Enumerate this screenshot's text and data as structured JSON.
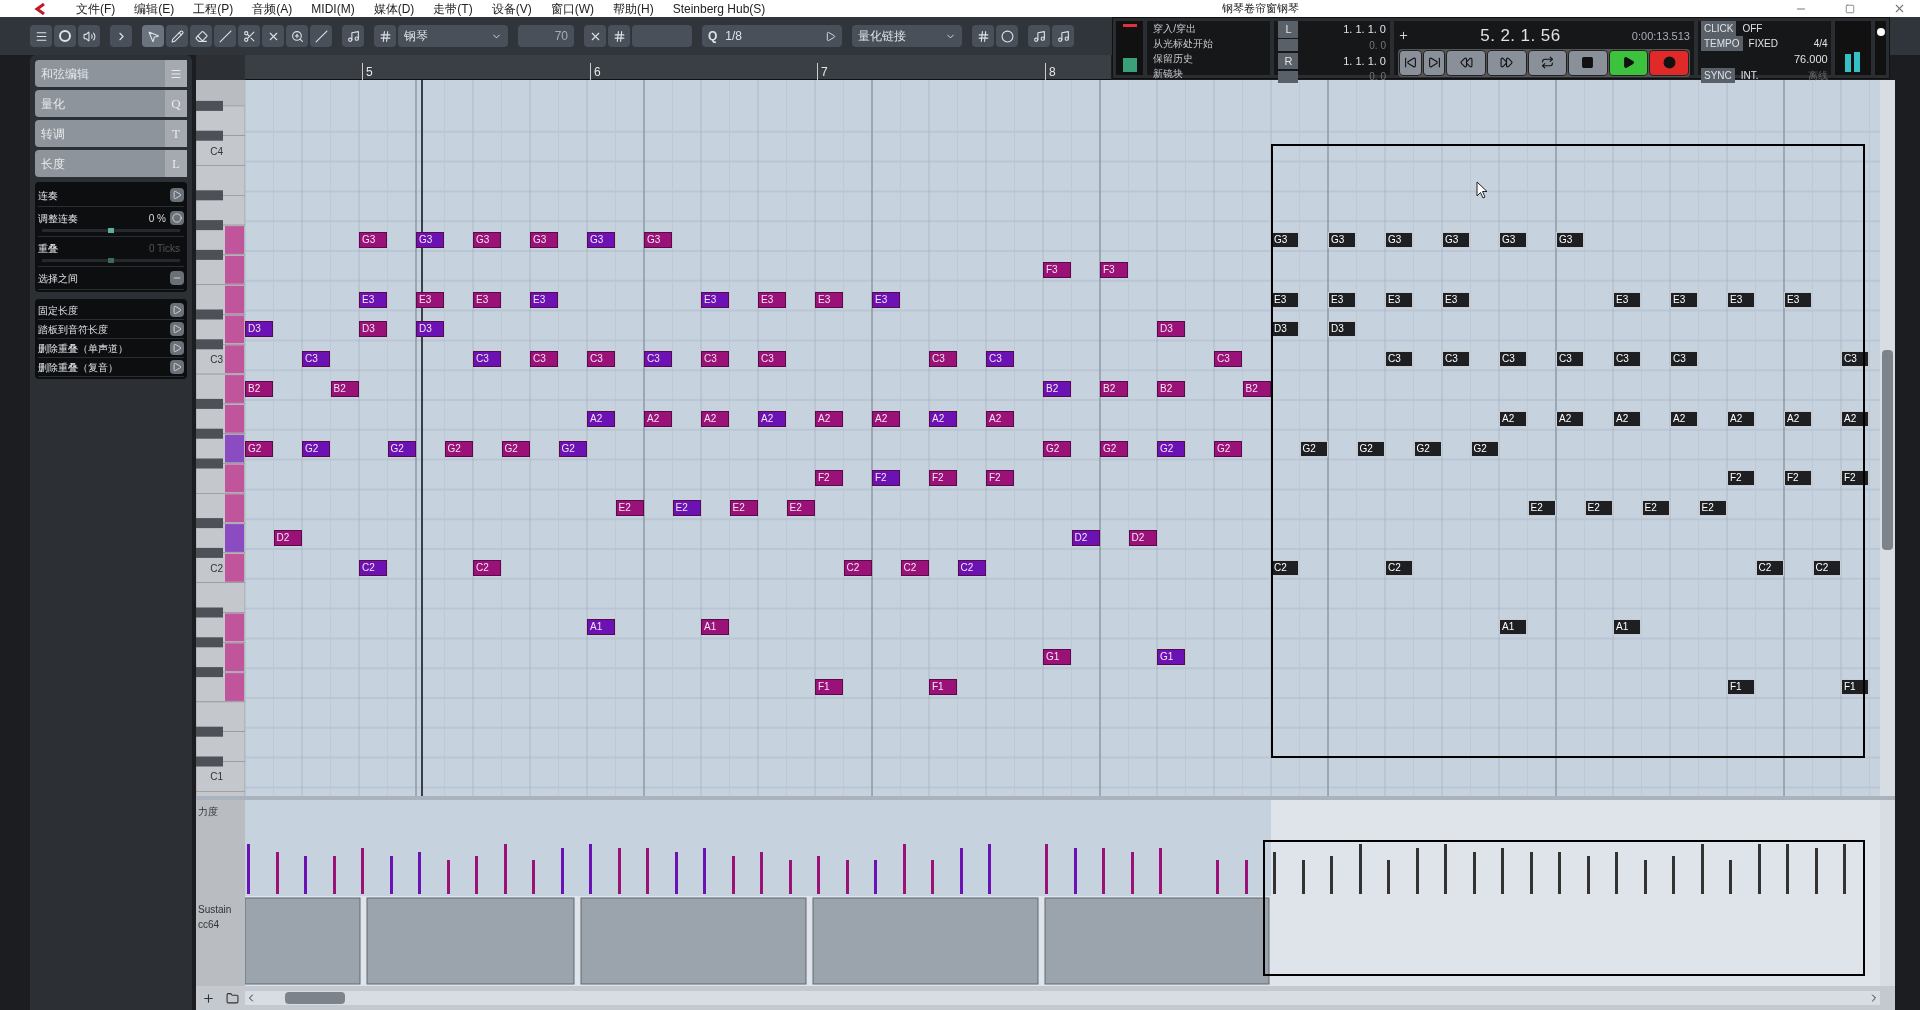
{
  "menu_bar": {
    "items": [
      "文件(F)",
      "编辑(E)",
      "工程(P)",
      "音频(A)",
      "MIDI(M)",
      "媒体(D)",
      "走带(T)",
      "设备(V)",
      "窗口(W)",
      "帮助(H)",
      "Steinberg Hub(S)"
    ]
  },
  "window": {
    "title": "钢琴卷帘窗钢琴"
  },
  "toolbar": {
    "instrument": "钢琴",
    "velocity": "70",
    "quantize_label": "Q",
    "quantize": "1/8",
    "length_quantize": "量化链接"
  },
  "transport": {
    "modes": [
      "穿入/穿出",
      "从光标处开始",
      "保留历史",
      "新镜块"
    ],
    "left_locator": {
      "label": "L",
      "position": "1. 1. 1. 0",
      "offset": "0. 0"
    },
    "right_locator": {
      "label": "R",
      "position": "1. 1. 1. 0",
      "offset": "0. 0"
    },
    "position": "5. 2. 1. 56",
    "time": "0:00:13.513",
    "buttons": [
      {
        "kind": "start",
        "on": false
      },
      {
        "kind": "end",
        "on": false
      },
      {
        "kind": "rewind",
        "on": false
      },
      {
        "kind": "forward",
        "on": false
      },
      {
        "kind": "cycle",
        "on": false
      },
      {
        "kind": "stop",
        "on": false
      },
      {
        "kind": "play",
        "on": true
      },
      {
        "kind": "record",
        "on": true
      }
    ],
    "click": {
      "label": "CLICK",
      "value": "OFF"
    },
    "tempo": {
      "label": "TEMPO",
      "value": "FIXED",
      "signature": "4/4",
      "bpm": "76.000"
    },
    "sync": {
      "label": "SYNC",
      "value": "INT.",
      "status": "离线"
    },
    "volume": {
      "level": 0.8
    }
  },
  "inspector": {
    "sections": [
      {
        "title": "和弦编辑",
        "kind": "icon"
      },
      {
        "title": "量化",
        "kind": "key",
        "key": "Q"
      },
      {
        "title": "转调",
        "kind": "key",
        "key": "T"
      },
      {
        "title": "长度",
        "kind": "key",
        "key": "L"
      }
    ],
    "legato": [
      {
        "kind": "button",
        "label": "连奏"
      },
      {
        "kind": "slider",
        "label": "调整连奏",
        "value": "0 %",
        "level": 0.5,
        "disabled": false
      },
      {
        "kind": "slider",
        "label": "重叠",
        "value": "0 Ticks",
        "level": 0.5,
        "disabled": true
      },
      {
        "kind": "toggle",
        "label": "选择之间"
      }
    ],
    "length_tools": [
      "固定长度",
      "踏板到音符长度",
      "删除重叠（单声道）",
      "删除重叠（复音）"
    ]
  },
  "ruler": {
    "bars": [
      "5",
      "6",
      "7",
      "8"
    ]
  },
  "keyboard": {
    "labels": [
      "C4",
      "C3",
      "C2",
      "C1"
    ]
  },
  "note_rows": [
    {
      "notes": [
        {
          "label": "G3",
          "selected": false
        },
        {
          "label": "G3",
          "selected": false
        },
        {
          "label": "G3",
          "selected": false
        },
        {
          "label": "G3",
          "selected": false
        },
        {
          "label": "G3",
          "selected": false
        },
        {
          "label": "G3",
          "selected": false
        },
        {
          "label": "G3",
          "selected": true
        },
        {
          "label": "G3",
          "selected": true
        },
        {
          "label": "G3",
          "selected": true
        },
        {
          "label": "G3",
          "selected": true
        },
        {
          "label": "G3",
          "selected": true
        },
        {
          "label": "G3",
          "selected": true
        }
      ]
    },
    {
      "notes": [
        {
          "label": "F3",
          "selected": false
        },
        {
          "label": "F3",
          "selected": false
        }
      ]
    },
    {
      "notes": [
        {
          "label": "E3",
          "selected": false
        },
        {
          "label": "E3",
          "selected": false
        },
        {
          "label": "E3",
          "selected": false
        },
        {
          "label": "E3",
          "selected": false
        },
        {
          "label": "E3",
          "selected": false
        },
        {
          "label": "E3",
          "selected": false
        },
        {
          "label": "E3",
          "selected": false
        },
        {
          "label": "E3",
          "selected": false
        },
        {
          "label": "E3",
          "selected": true
        },
        {
          "label": "E3",
          "selected": true
        },
        {
          "label": "E3",
          "selected": true
        },
        {
          "label": "E3",
          "selected": true
        },
        {
          "label": "E3",
          "selected": true
        },
        {
          "label": "E3",
          "selected": true
        },
        {
          "label": "E3",
          "selected": true
        },
        {
          "label": "E3",
          "selected": true
        }
      ]
    },
    {
      "notes": [
        {
          "label": "D3",
          "selected": false
        },
        {
          "label": "D3",
          "selected": false
        },
        {
          "label": "D3",
          "selected": false
        },
        {
          "label": "D3",
          "selected": false
        },
        {
          "label": "D3",
          "selected": true
        },
        {
          "label": "D3",
          "selected": true
        }
      ]
    },
    {
      "notes": [
        {
          "label": "C3",
          "selected": false
        },
        {
          "label": "C3",
          "selected": false
        },
        {
          "label": "C3",
          "selected": false
        },
        {
          "label": "C3",
          "selected": false
        },
        {
          "label": "C3",
          "selected": false
        },
        {
          "label": "C3",
          "selected": false
        },
        {
          "label": "C3",
          "selected": false
        },
        {
          "label": "C3",
          "selected": false
        },
        {
          "label": "C3",
          "selected": false
        },
        {
          "label": "C3",
          "selected": false
        },
        {
          "label": "C3",
          "selected": true
        },
        {
          "label": "C3",
          "selected": true
        },
        {
          "label": "C3",
          "selected": true
        },
        {
          "label": "C3",
          "selected": true
        },
        {
          "label": "C3",
          "selected": true
        },
        {
          "label": "C3",
          "selected": true
        },
        {
          "label": "C3",
          "selected": true
        }
      ]
    },
    {
      "notes": [
        {
          "label": "B2",
          "selected": false
        },
        {
          "label": "B2",
          "selected": false
        },
        {
          "label": "B2",
          "selected": false
        },
        {
          "label": "B2",
          "selected": false
        },
        {
          "label": "B2",
          "selected": false
        },
        {
          "label": "B2",
          "selected": false
        }
      ]
    },
    {
      "notes": [
        {
          "label": "A2",
          "selected": false
        },
        {
          "label": "A2",
          "selected": false
        },
        {
          "label": "A2",
          "selected": false
        },
        {
          "label": "A2",
          "selected": false
        },
        {
          "label": "A2",
          "selected": false
        },
        {
          "label": "A2",
          "selected": false
        },
        {
          "label": "A2",
          "selected": false
        },
        {
          "label": "A2",
          "selected": false
        },
        {
          "label": "A2",
          "selected": true
        },
        {
          "label": "A2",
          "selected": true
        },
        {
          "label": "A2",
          "selected": true
        },
        {
          "label": "A2",
          "selected": true
        },
        {
          "label": "A2",
          "selected": true
        },
        {
          "label": "A2",
          "selected": true
        },
        {
          "label": "A2",
          "selected": true
        }
      ]
    },
    {
      "notes": [
        {
          "label": "G2",
          "selected": false
        },
        {
          "label": "G2",
          "selected": false
        },
        {
          "label": "G2",
          "selected": false
        },
        {
          "label": "G2",
          "selected": false
        },
        {
          "label": "G2",
          "selected": false
        },
        {
          "label": "G2",
          "selected": false
        },
        {
          "label": "G2",
          "selected": false
        },
        {
          "label": "G2",
          "selected": false
        },
        {
          "label": "G2",
          "selected": false
        },
        {
          "label": "G2",
          "selected": false
        },
        {
          "label": "G2",
          "selected": true
        },
        {
          "label": "G2",
          "selected": true
        },
        {
          "label": "G2",
          "selected": true
        },
        {
          "label": "G2",
          "selected": true
        }
      ]
    },
    {
      "notes": [
        {
          "label": "F2",
          "selected": false
        },
        {
          "label": "F2",
          "selected": false
        },
        {
          "label": "F2",
          "selected": false
        },
        {
          "label": "F2",
          "selected": false
        },
        {
          "label": "F2",
          "selected": true
        },
        {
          "label": "F2",
          "selected": true
        },
        {
          "label": "F2",
          "selected": true
        }
      ]
    },
    {
      "notes": [
        {
          "label": "E2",
          "selected": false
        },
        {
          "label": "E2",
          "selected": false
        },
        {
          "label": "E2",
          "selected": false
        },
        {
          "label": "E2",
          "selected": false
        },
        {
          "label": "E2",
          "selected": true
        },
        {
          "label": "E2",
          "selected": true
        },
        {
          "label": "E2",
          "selected": true
        },
        {
          "label": "E2",
          "selected": true
        }
      ]
    },
    {
      "notes": [
        {
          "label": "D2",
          "selected": false
        },
        {
          "label": "D2",
          "selected": false
        },
        {
          "label": "D2",
          "selected": false
        }
      ]
    },
    {
      "notes": [
        {
          "label": "C2",
          "selected": false
        },
        {
          "label": "C2",
          "selected": false
        },
        {
          "label": "C2",
          "selected": false
        },
        {
          "label": "C2",
          "selected": false
        },
        {
          "label": "C2",
          "selected": false
        },
        {
          "label": "C2",
          "selected": true
        },
        {
          "label": "C2",
          "selected": true
        },
        {
          "label": "C2",
          "selected": true
        },
        {
          "label": "C2",
          "selected": true
        }
      ]
    },
    {
      "notes": [
        {
          "label": "A1",
          "selected": false
        },
        {
          "label": "A1",
          "selected": false
        },
        {
          "label": "A1",
          "selected": true
        },
        {
          "label": "A1",
          "selected": true
        }
      ]
    },
    {
      "notes": [
        {
          "label": "G1",
          "selected": false
        },
        {
          "label": "G1",
          "selected": false
        }
      ]
    },
    {
      "notes": [
        {
          "label": "F1",
          "selected": false
        },
        {
          "label": "F1",
          "selected": false
        },
        {
          "label": "F1",
          "selected": true
        },
        {
          "label": "F1",
          "selected": true
        }
      ]
    }
  ],
  "lanes": [
    {
      "label": "力度"
    },
    {
      "label": "Sustain",
      "sublabel": "cc64"
    }
  ]
}
